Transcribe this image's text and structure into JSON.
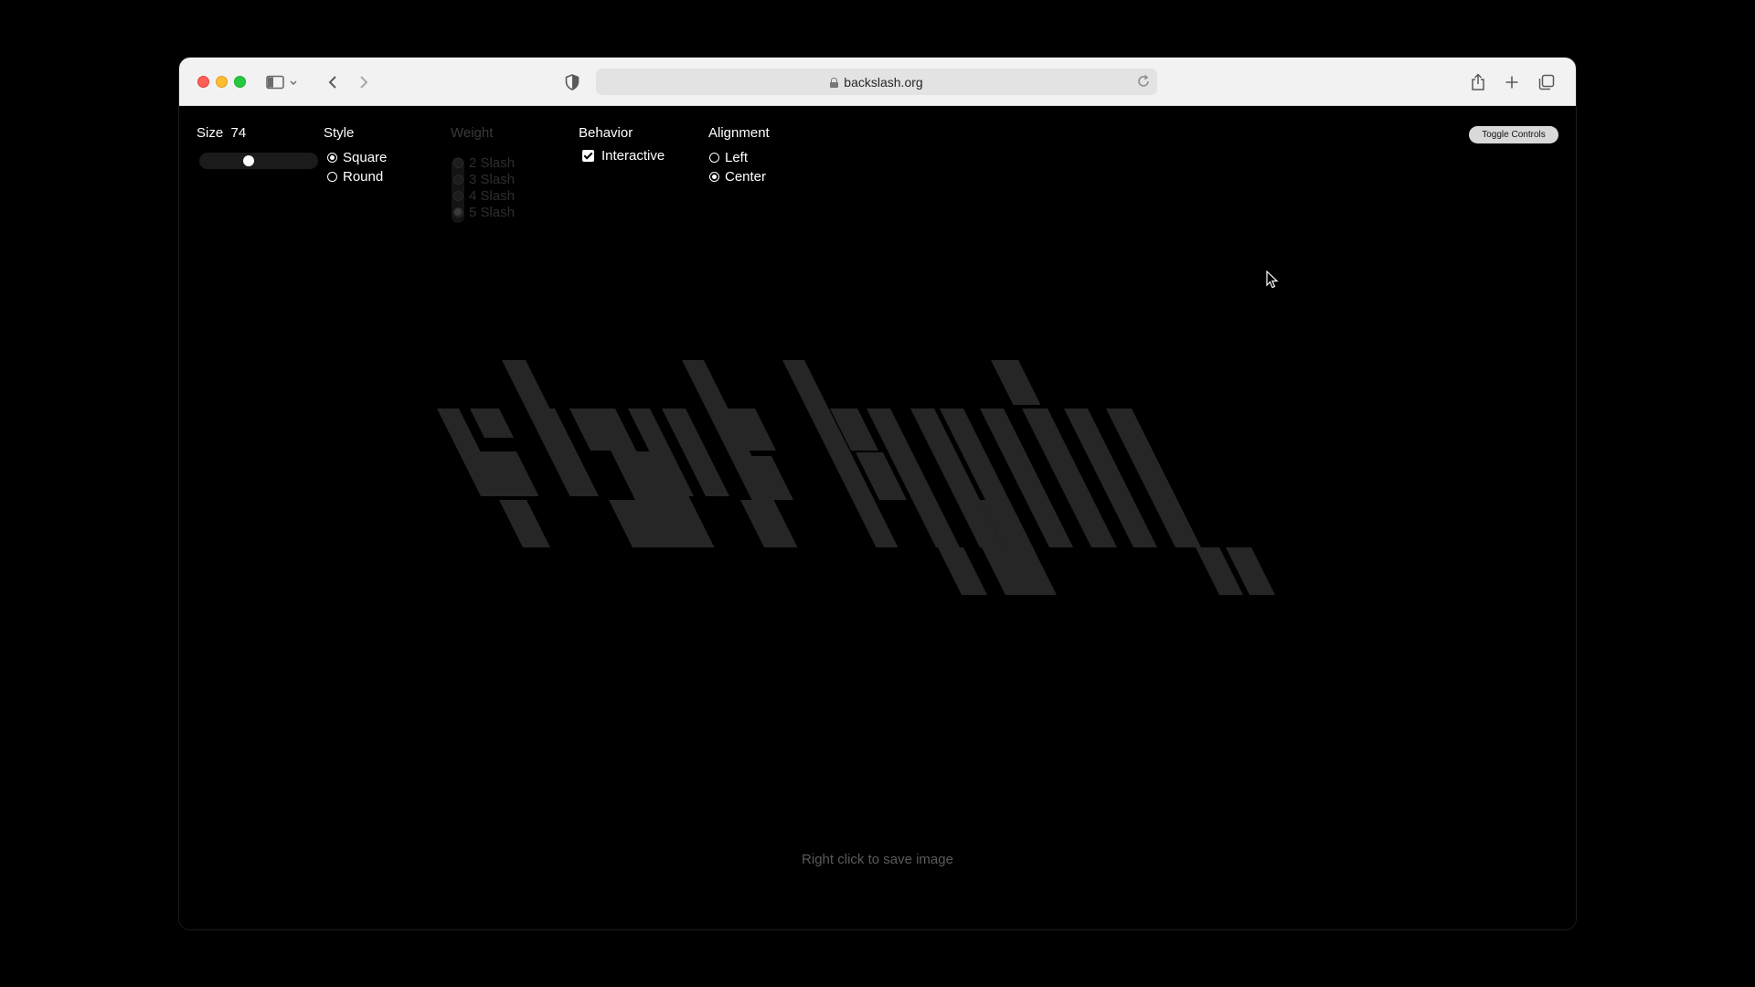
{
  "browser": {
    "url": "backslash.org"
  },
  "controls": {
    "size_label": "Size",
    "size_value": "74",
    "size_fraction": 0.4,
    "style_label": "Style",
    "style_options": [
      {
        "label": "Square",
        "selected": true
      },
      {
        "label": "Round",
        "selected": false
      }
    ],
    "weight_label": "Weight",
    "weight_options": [
      {
        "label": "2 Slash",
        "selected": false
      },
      {
        "label": "3 Slash",
        "selected": false
      },
      {
        "label": "4 Slash",
        "selected": false
      },
      {
        "label": "5 Slash",
        "selected": true
      }
    ],
    "behavior_label": "Behavior",
    "interactive_label": "Interactive",
    "interactive_checked": true,
    "alignment_label": "Alignment",
    "alignment_options": [
      {
        "label": "Left",
        "selected": false
      },
      {
        "label": "Center",
        "selected": true
      }
    ],
    "toggle_button": "Toggle Controls"
  },
  "canvas": {
    "stripe_color": "#262626",
    "footer_hint": "Right click to save image"
  },
  "colors": {
    "background": "#000000",
    "chrome": "#f3f2f2"
  }
}
